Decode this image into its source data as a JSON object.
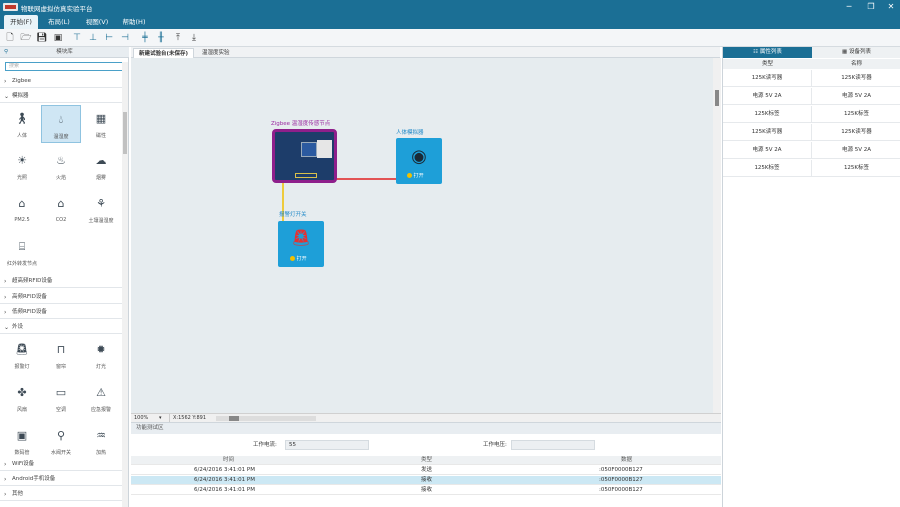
{
  "window": {
    "title": "物联网虚拟仿真实验平台"
  },
  "menu": [
    {
      "label": "开始(F)"
    },
    {
      "label": "布局(L)"
    },
    {
      "label": "视图(V)"
    },
    {
      "label": "帮助(H)"
    }
  ],
  "left": {
    "title": "模块库",
    "search_placeholder": "搜索",
    "categories": [
      "Zigbee",
      "模拟器",
      "超高频RFID设备",
      "高频RFID设备",
      "低频RFID设备",
      "外设",
      "WiFi设备",
      "Android手机设备",
      "其他"
    ],
    "sensors": [
      "人体",
      "温湿度",
      "磁性",
      "光照",
      "火焰",
      "烟雾",
      "PM2.5",
      "CO2",
      "土壤温湿度",
      "红外转发节点"
    ],
    "peripherals": [
      "报警灯",
      "窗帘",
      "灯光",
      "风扇",
      "空调",
      "应急报警",
      "数码管",
      "水阀开关",
      "加热"
    ]
  },
  "tabs": [
    {
      "label": "新建试验台(未保存)"
    },
    {
      "label": "温湿度实验"
    }
  ],
  "canvas": {
    "zigbee_node_label": "Zigbee 温湿度传感节点",
    "body_sensor_label": "人体模拟器",
    "alarm_label": "报警灯开关",
    "open_label": "打开"
  },
  "status": {
    "zoom": "100%",
    "coords": "X:1562 Y:891"
  },
  "bottom": {
    "title": "功能测试区",
    "current_label": "工作电流:",
    "current_value": "55",
    "voltage_label": "工作电压:",
    "voltage_value": "",
    "columns": [
      "时间",
      "类型",
      "数据"
    ],
    "rows": [
      {
        "time": "6/24/2016  3:41:01  PM",
        "type": "发送",
        "data": ":050F0000B127"
      },
      {
        "time": "6/24/2016  3:41:01  PM",
        "type": "接收",
        "data": ":050F0000B127"
      },
      {
        "time": "6/24/2016  3:41:01  PM",
        "type": "接收",
        "data": ":050F0000B127"
      }
    ]
  },
  "right": {
    "tabs": [
      "属性列表",
      "设备列表"
    ],
    "columns": [
      "类型",
      "名称"
    ],
    "rows": [
      {
        "type": "125K读写器",
        "name": "125K读写器"
      },
      {
        "type": "电源 5V  2A",
        "name": "电源 5V  2A"
      },
      {
        "type": "125K标签",
        "name": "125K标签"
      },
      {
        "type": "125K读写器",
        "name": "125K读写器"
      },
      {
        "type": "电源 5V  2A",
        "name": "电源 5V  2A"
      },
      {
        "type": "125K标签",
        "name": "125K标签"
      }
    ]
  },
  "colors": {
    "brand": "#1b6f95",
    "node_border": "#8e1f8b",
    "tile": "#1e9fd8",
    "wire_red": "#e02020",
    "wire_yellow": "#f0c000"
  }
}
